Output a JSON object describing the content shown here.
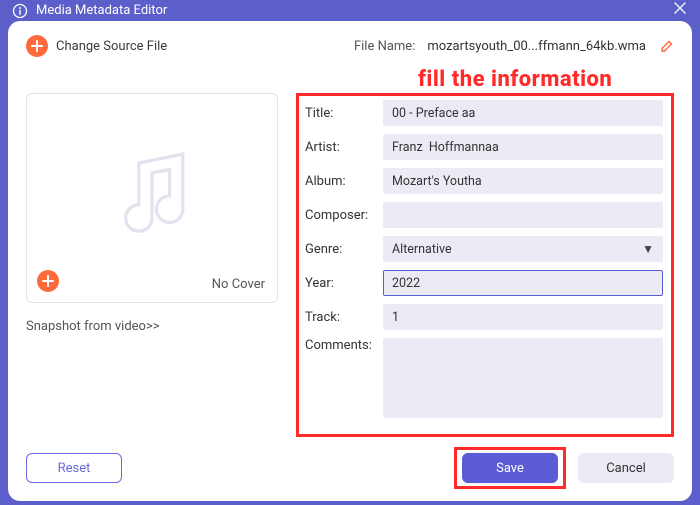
{
  "titlebar": {
    "title": "Media Metadata Editor"
  },
  "toprow": {
    "change_source_label": "Change Source File",
    "filename_label": "File Name:",
    "filename_value": "mozartsyouth_00...ffmann_64kb.wma"
  },
  "callout": "fill the information",
  "cover": {
    "no_cover_label": "No Cover",
    "snapshot_label": "Snapshot from video>>"
  },
  "form": {
    "title": {
      "label": "Title:",
      "value": "00 - Preface aa"
    },
    "artist": {
      "label": "Artist:",
      "value": "Franz  Hoffmannaa"
    },
    "album": {
      "label": "Album:",
      "value": "Mozart's Youtha"
    },
    "composer": {
      "label": "Composer:",
      "value": ""
    },
    "genre": {
      "label": "Genre:",
      "selected": "Alternative"
    },
    "year": {
      "label": "Year:",
      "value": "2022"
    },
    "track": {
      "label": "Track:",
      "value": "1"
    },
    "comments": {
      "label": "Comments:",
      "value": ""
    }
  },
  "buttons": {
    "reset": "Reset",
    "save": "Save",
    "cancel": "Cancel"
  }
}
